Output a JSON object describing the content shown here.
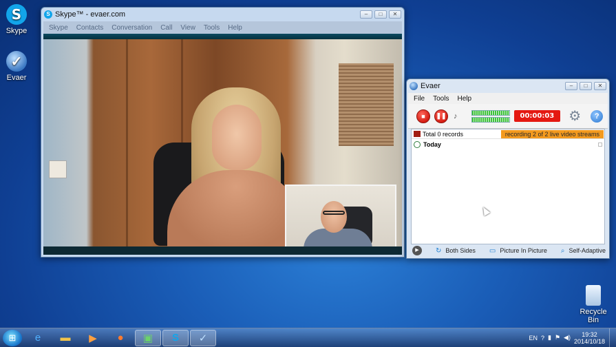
{
  "desktop": {
    "icons": [
      {
        "label": "Skype",
        "glyph": "S"
      },
      {
        "label": "Evaer",
        "glyph": "✓"
      },
      {
        "label": "Recycle Bin",
        "glyph": ""
      }
    ]
  },
  "skype_window": {
    "title": "Skype™ - evaer.com",
    "menu": [
      "Skype",
      "Contacts",
      "Conversation",
      "Call",
      "View",
      "Tools",
      "Help"
    ]
  },
  "evaer_window": {
    "title": "Evaer",
    "menu": [
      "File",
      "Tools",
      "Help"
    ],
    "timer": "00:00:03",
    "records_label": "Total 0 records",
    "status_badge": "recording 2 of 2 live video streams",
    "group_label": "Today",
    "options": [
      "Both Sides",
      "Picture In Picture",
      "Self-Adaptive"
    ]
  },
  "taskbar": {
    "items": [
      "ie-icon",
      "explorer-icon",
      "media-player-icon",
      "firefox-icon",
      "app-icon",
      "skype-icon",
      "evaer-icon"
    ],
    "tray": {
      "lang": "EN",
      "time": "19:32",
      "date": "2014/10/18"
    }
  },
  "colors": {
    "recording_red": "#e41912",
    "badge_orange": "#f39a1e",
    "skype_blue": "#12a5ea"
  }
}
